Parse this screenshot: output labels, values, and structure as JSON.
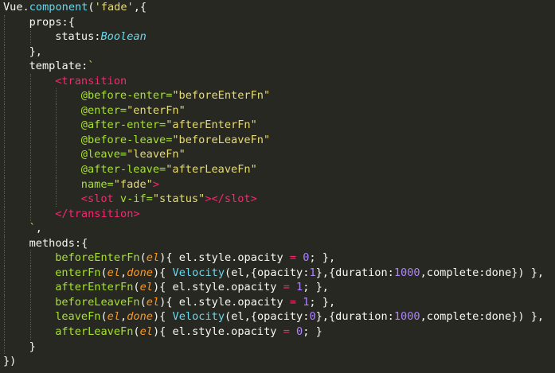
{
  "editor": {
    "theme_colors": {
      "background": "#272822",
      "foreground": "#f8f8f2",
      "function": "#66d9ef",
      "string": "#e6db74",
      "tag": "#f92672",
      "attribute": "#a6e22e",
      "parameter": "#fd971f",
      "number": "#ae81ff"
    },
    "lines": [
      {
        "indent": 0,
        "tokens": [
          {
            "t": "Vue.",
            "c": "default"
          },
          {
            "t": "component",
            "c": "fn"
          },
          {
            "t": "(",
            "c": "punct"
          },
          {
            "t": "'fade'",
            "c": "str"
          },
          {
            "t": ",{",
            "c": "punct"
          }
        ]
      },
      {
        "indent": 1,
        "tokens": [
          {
            "t": "props:{",
            "c": "default"
          }
        ]
      },
      {
        "indent": 2,
        "tokens": [
          {
            "t": "status:",
            "c": "default"
          },
          {
            "t": "Boolean",
            "c": "type"
          }
        ]
      },
      {
        "indent": 1,
        "tokens": [
          {
            "t": "},",
            "c": "default"
          }
        ]
      },
      {
        "indent": 1,
        "tokens": [
          {
            "t": "template:",
            "c": "default"
          },
          {
            "t": "`",
            "c": "str"
          }
        ]
      },
      {
        "indent": 2,
        "tokens": [
          {
            "t": "<transition",
            "c": "tag"
          }
        ]
      },
      {
        "indent": 3,
        "tokens": [
          {
            "t": "@before-enter=",
            "c": "attr"
          },
          {
            "t": "\"beforeEnterFn\"",
            "c": "str"
          }
        ]
      },
      {
        "indent": 3,
        "tokens": [
          {
            "t": "@enter=",
            "c": "attr"
          },
          {
            "t": "\"enterFn\"",
            "c": "str"
          }
        ]
      },
      {
        "indent": 3,
        "tokens": [
          {
            "t": "@after-enter=",
            "c": "attr"
          },
          {
            "t": "\"afterEnterFn\"",
            "c": "str"
          }
        ]
      },
      {
        "indent": 3,
        "tokens": [
          {
            "t": "@before-leave=",
            "c": "attr"
          },
          {
            "t": "\"beforeLeaveFn\"",
            "c": "str"
          }
        ]
      },
      {
        "indent": 3,
        "tokens": [
          {
            "t": "@leave=",
            "c": "attr"
          },
          {
            "t": "\"leaveFn\"",
            "c": "str"
          }
        ]
      },
      {
        "indent": 3,
        "tokens": [
          {
            "t": "@after-leave=",
            "c": "attr"
          },
          {
            "t": "\"afterLeaveFn\"",
            "c": "str"
          }
        ]
      },
      {
        "indent": 3,
        "tokens": [
          {
            "t": "name=",
            "c": "attr"
          },
          {
            "t": "\"fade\"",
            "c": "str"
          },
          {
            "t": ">",
            "c": "tag"
          }
        ]
      },
      {
        "indent": 3,
        "tokens": [
          {
            "t": "<slot ",
            "c": "tag"
          },
          {
            "t": "v-if=",
            "c": "attr"
          },
          {
            "t": "\"status\"",
            "c": "str"
          },
          {
            "t": "></slot>",
            "c": "tag"
          }
        ]
      },
      {
        "indent": 2,
        "tokens": [
          {
            "t": "</transition>",
            "c": "tag"
          }
        ]
      },
      {
        "indent": 1,
        "tokens": [
          {
            "t": "`",
            "c": "str"
          },
          {
            "t": ",",
            "c": "default"
          }
        ]
      },
      {
        "indent": 1,
        "tokens": [
          {
            "t": "methods:{",
            "c": "default"
          }
        ]
      },
      {
        "indent": 2,
        "tokens": [
          {
            "t": "beforeEnterFn",
            "c": "method"
          },
          {
            "t": "(",
            "c": "punct"
          },
          {
            "t": "el",
            "c": "param"
          },
          {
            "t": "){ el.style.opacity ",
            "c": "default"
          },
          {
            "t": "=",
            "c": "op"
          },
          {
            "t": " ",
            "c": "default"
          },
          {
            "t": "0",
            "c": "num"
          },
          {
            "t": "; },",
            "c": "default"
          }
        ]
      },
      {
        "indent": 2,
        "tokens": [
          {
            "t": "enterFn",
            "c": "method"
          },
          {
            "t": "(",
            "c": "punct"
          },
          {
            "t": "el",
            "c": "param"
          },
          {
            "t": ",",
            "c": "punct"
          },
          {
            "t": "done",
            "c": "param"
          },
          {
            "t": "){ ",
            "c": "default"
          },
          {
            "t": "Velocity",
            "c": "fn"
          },
          {
            "t": "(el,{opacity:",
            "c": "default"
          },
          {
            "t": "1",
            "c": "num"
          },
          {
            "t": "},{duration:",
            "c": "default"
          },
          {
            "t": "1000",
            "c": "num"
          },
          {
            "t": ",complete:done}) },",
            "c": "default"
          }
        ]
      },
      {
        "indent": 2,
        "tokens": [
          {
            "t": "afterEnterFn",
            "c": "method"
          },
          {
            "t": "(",
            "c": "punct"
          },
          {
            "t": "el",
            "c": "param"
          },
          {
            "t": "){ el.style.opacity ",
            "c": "default"
          },
          {
            "t": "=",
            "c": "op"
          },
          {
            "t": " ",
            "c": "default"
          },
          {
            "t": "1",
            "c": "num"
          },
          {
            "t": "; },",
            "c": "default"
          }
        ]
      },
      {
        "indent": 2,
        "tokens": [
          {
            "t": "beforeLeaveFn",
            "c": "method"
          },
          {
            "t": "(",
            "c": "punct"
          },
          {
            "t": "el",
            "c": "param"
          },
          {
            "t": "){ el.style.opacity ",
            "c": "default"
          },
          {
            "t": "=",
            "c": "op"
          },
          {
            "t": " ",
            "c": "default"
          },
          {
            "t": "1",
            "c": "num"
          },
          {
            "t": "; },",
            "c": "default"
          }
        ]
      },
      {
        "indent": 2,
        "tokens": [
          {
            "t": "leaveFn",
            "c": "method"
          },
          {
            "t": "(",
            "c": "punct"
          },
          {
            "t": "el",
            "c": "param"
          },
          {
            "t": ",",
            "c": "punct"
          },
          {
            "t": "done",
            "c": "param"
          },
          {
            "t": "){ ",
            "c": "default"
          },
          {
            "t": "Velocity",
            "c": "fn"
          },
          {
            "t": "(el,{opacity:",
            "c": "default"
          },
          {
            "t": "0",
            "c": "num"
          },
          {
            "t": "},{duration:",
            "c": "default"
          },
          {
            "t": "1000",
            "c": "num"
          },
          {
            "t": ",complete:done}) },",
            "c": "default"
          }
        ]
      },
      {
        "indent": 2,
        "tokens": [
          {
            "t": "afterLeaveFn",
            "c": "method"
          },
          {
            "t": "(",
            "c": "punct"
          },
          {
            "t": "el",
            "c": "param"
          },
          {
            "t": "){ el.style.opacity ",
            "c": "default"
          },
          {
            "t": "=",
            "c": "op"
          },
          {
            "t": " ",
            "c": "default"
          },
          {
            "t": "0",
            "c": "num"
          },
          {
            "t": "; }",
            "c": "default"
          }
        ]
      },
      {
        "indent": 1,
        "tokens": [
          {
            "t": "}",
            "c": "default"
          }
        ]
      },
      {
        "indent": 0,
        "tokens": [
          {
            "t": "})",
            "c": "default"
          }
        ]
      }
    ]
  }
}
